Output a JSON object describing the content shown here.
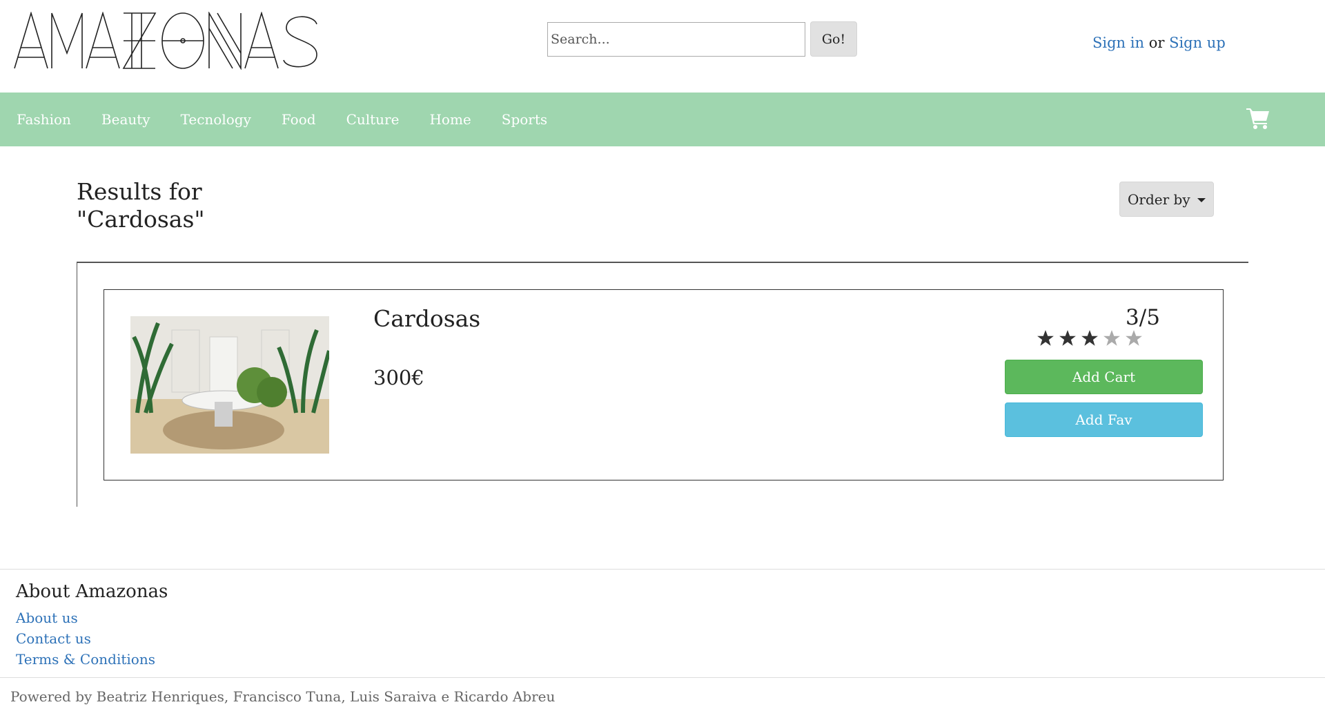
{
  "header": {
    "logo_text": "AMAZONAS",
    "search": {
      "placeholder": "Search...",
      "value": ""
    },
    "go_label": "Go!",
    "auth": {
      "sign_in": "Sign in",
      "or": "or",
      "sign_up": "Sign up"
    }
  },
  "nav": {
    "items": [
      "Fashion",
      "Beauty",
      "Tecnology",
      "Food",
      "Culture",
      "Home",
      "Sports"
    ],
    "cart_icon": "shopping-cart-icon",
    "background": "#9fd6af"
  },
  "results": {
    "title_line1": "Results for",
    "title_line2": "\"Cardosas\"",
    "order_label": "Order by"
  },
  "product": {
    "name": "Cardosas",
    "price": "300€",
    "rating_text": "3/5",
    "rating": 3,
    "rating_max": 5,
    "add_cart_label": "Add Cart",
    "add_fav_label": "Add Fav",
    "image_icon": "product-photo"
  },
  "footer": {
    "heading": "About Amazonas",
    "links": [
      "About us",
      "Contact us",
      "Terms & Conditions"
    ],
    "powered_by": "Powered by Beatriz Henriques, Francisco Tuna, Luis Saraiva e Ricardo Abreu"
  },
  "colors": {
    "link": "#2e72b8",
    "add_cart": "#5cb85c",
    "add_fav": "#5bc0de"
  }
}
